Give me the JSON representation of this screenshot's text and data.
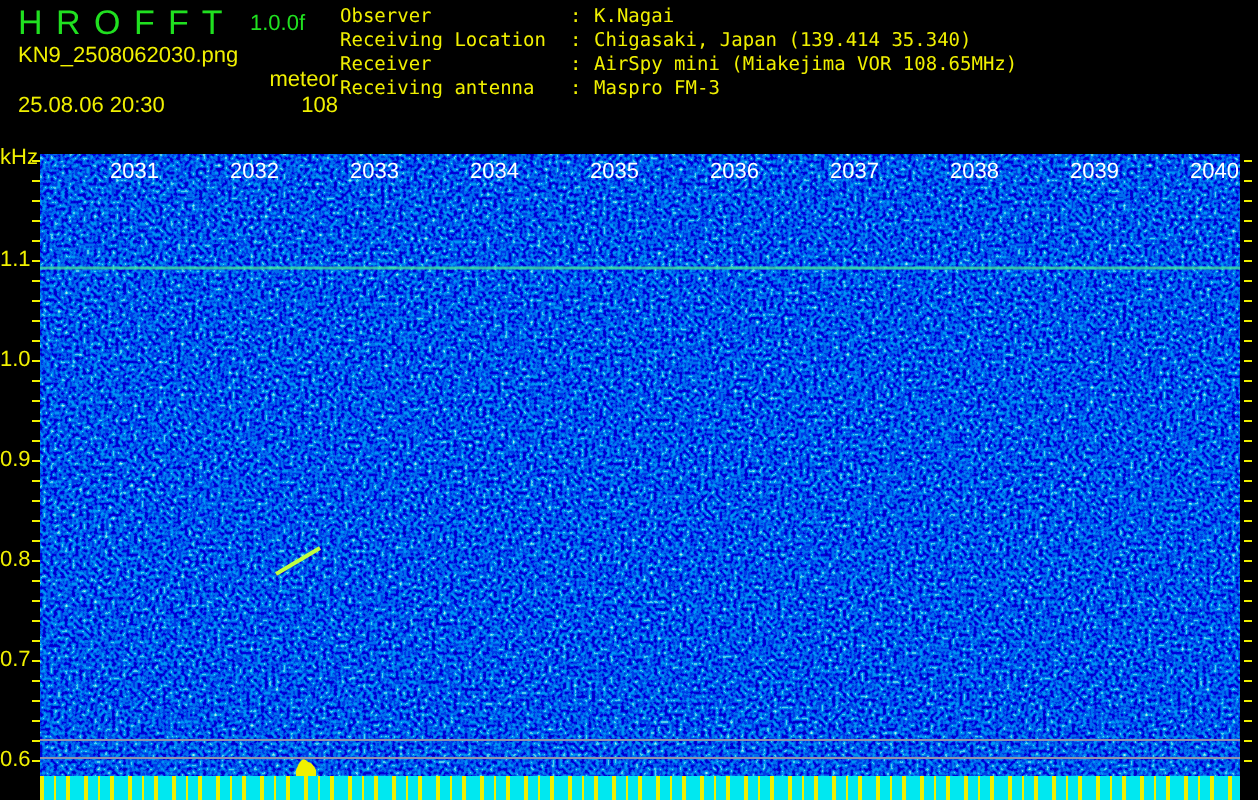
{
  "header": {
    "app_name": "H R O F F T",
    "version": "1.0.0f",
    "filename": "KN9_2508062030.png",
    "datetime": "25.08.06 20:30",
    "count_label": "meteor",
    "count": "108"
  },
  "info": [
    {
      "label": "Observer",
      "separator": ":",
      "value": "K.Nagai"
    },
    {
      "label": "Receiving Location",
      "separator": ":",
      "value": "Chigasaki, Japan (139.414 35.340)"
    },
    {
      "label": "Receiver",
      "separator": ":",
      "value": "AirSpy mini (Miakejima VOR 108.65MHz)"
    },
    {
      "label": "Receiving antenna",
      "separator": ":",
      "value": "Maspro FM-3"
    }
  ],
  "spectrogram": {
    "unit": "kHz",
    "time_labels": [
      "2031",
      "2032",
      "2033",
      "2034",
      "2035",
      "2036",
      "2037",
      "2038",
      "2039",
      "2040"
    ],
    "frequency_labels": [
      "1.1",
      "1.0",
      "0.9",
      "0.8",
      "0.7",
      "0.6"
    ]
  }
}
